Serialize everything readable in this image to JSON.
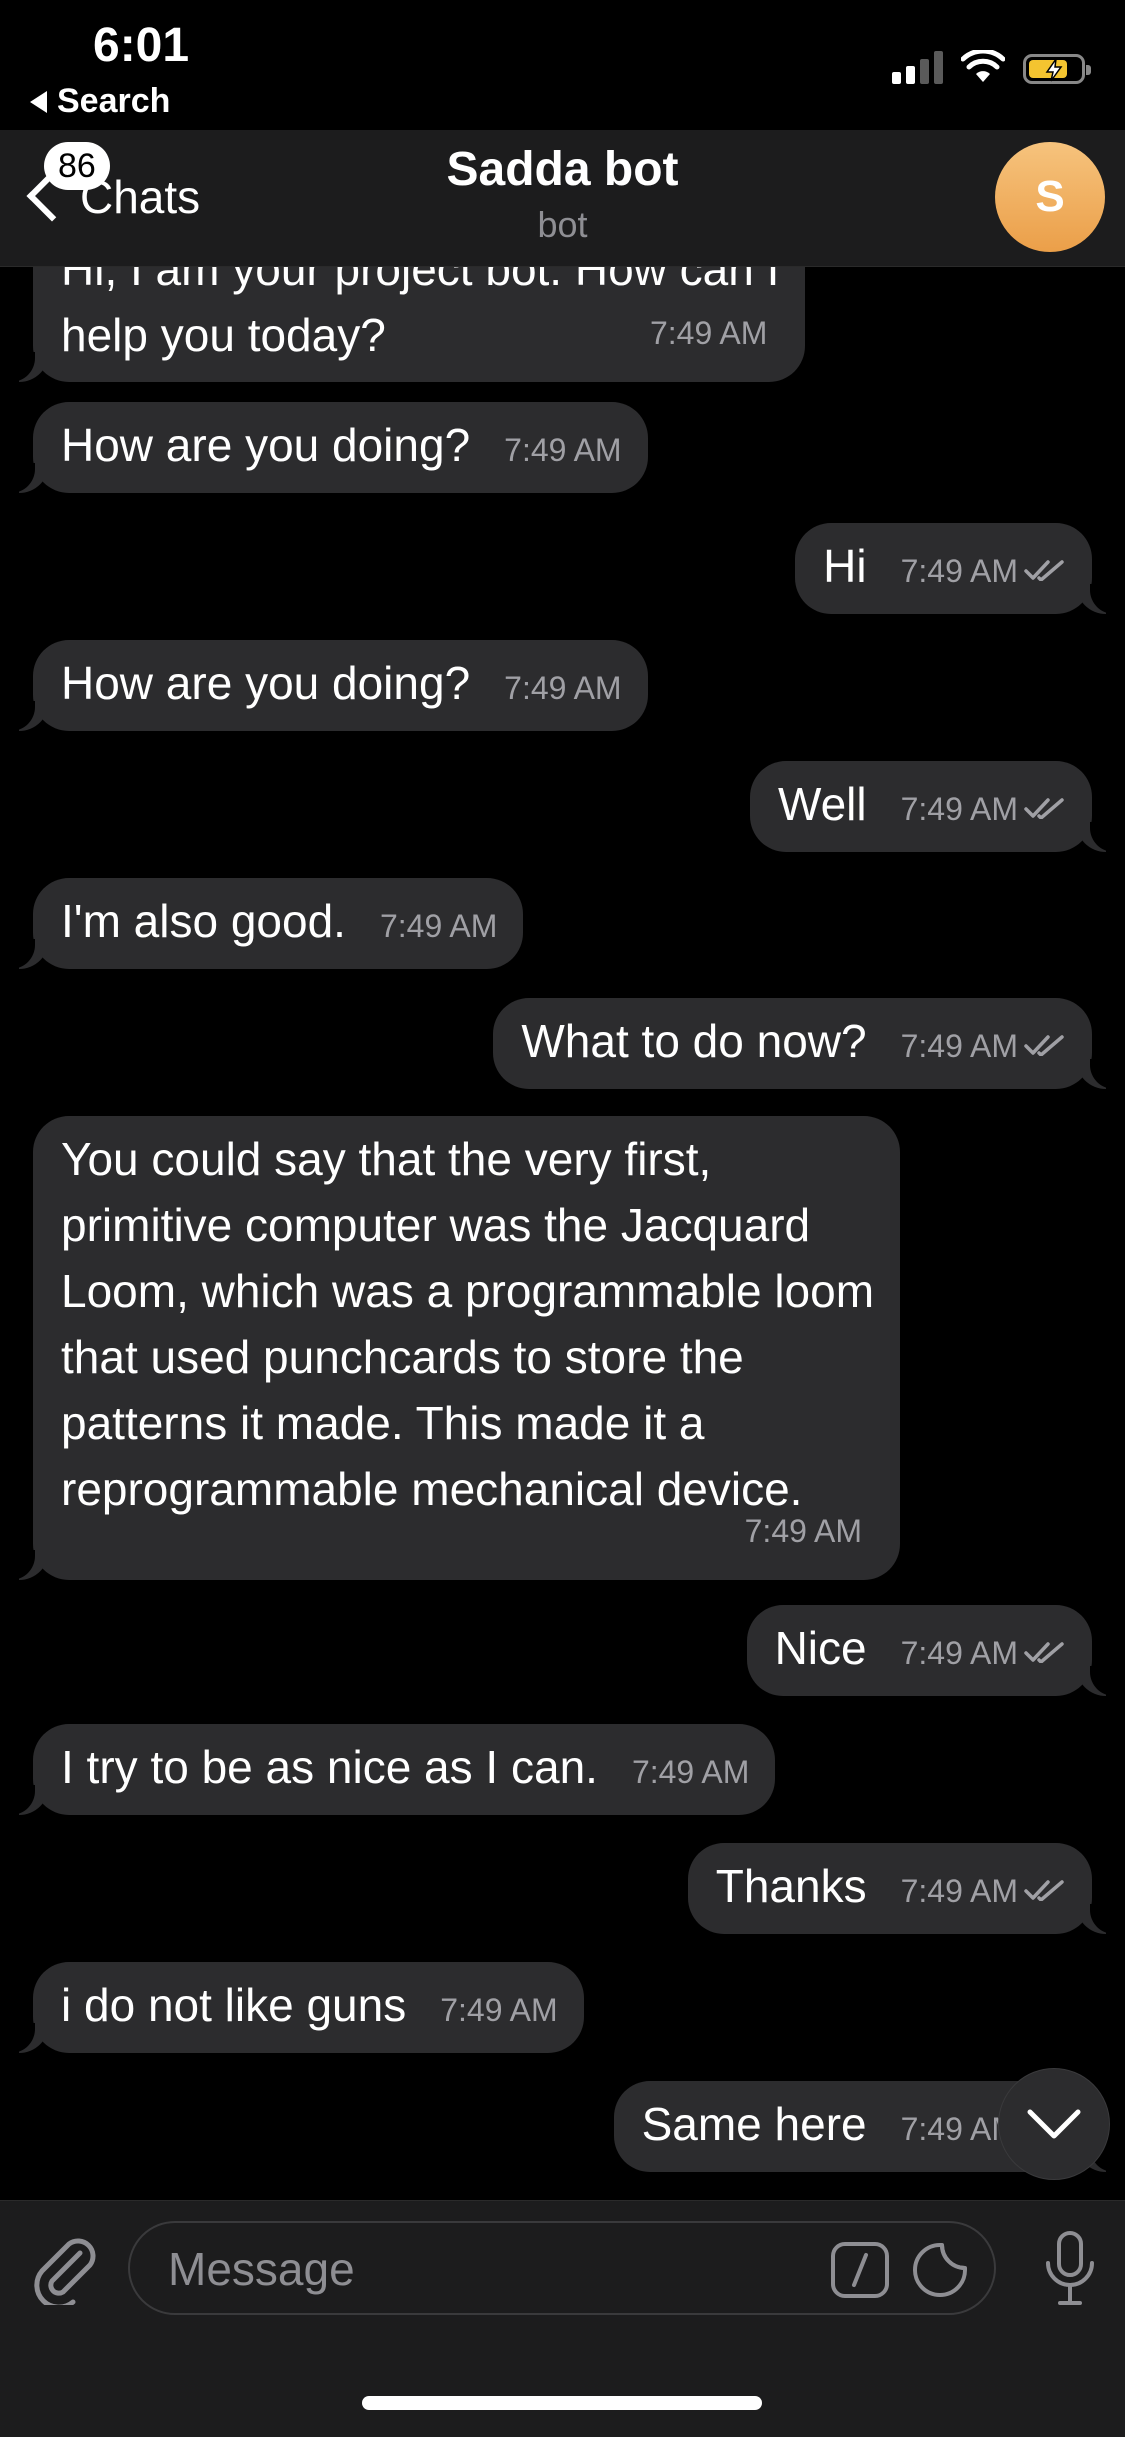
{
  "status_bar": {
    "time": "6:01",
    "back_app": "Search"
  },
  "header": {
    "back_label": "Chats",
    "unread_badge": "86",
    "title": "Sadda bot",
    "subtitle": "bot",
    "avatar_initial": "S"
  },
  "messages": [
    {
      "dir": "in",
      "text": "Hi, I am your project bot. How can I\nhelp you today?",
      "time": "7:49 AM"
    },
    {
      "dir": "in",
      "text": "How are you doing?",
      "time": "7:49 AM"
    },
    {
      "dir": "out",
      "text": "Hi",
      "time": "7:49 AM"
    },
    {
      "dir": "in",
      "text": "How are you doing?",
      "time": "7:49 AM"
    },
    {
      "dir": "out",
      "text": "Well",
      "time": "7:49 AM"
    },
    {
      "dir": "in",
      "text": "I'm also good.",
      "time": "7:49 AM"
    },
    {
      "dir": "out",
      "text": "What to do now?",
      "time": "7:49 AM"
    },
    {
      "dir": "in",
      "text": "You could say that the very first,\nprimitive computer was the Jacquard\nLoom, which was a programmable loom\nthat used punchcards to store the\npatterns it made. This made it a\nreprogrammable mechanical device.",
      "time": "7:49 AM"
    },
    {
      "dir": "out",
      "text": "Nice",
      "time": "7:49 AM"
    },
    {
      "dir": "in",
      "text": "I try to be as nice as I can.",
      "time": "7:49 AM"
    },
    {
      "dir": "out",
      "text": "Thanks",
      "time": "7:49 AM"
    },
    {
      "dir": "in",
      "text": "i do not like guns",
      "time": "7:49 AM"
    },
    {
      "dir": "out",
      "text": "Same here",
      "time": "7:49 AM"
    }
  ],
  "composer": {
    "placeholder": "Message"
  },
  "colors": {
    "bubble": "#2c2c2e",
    "background": "#000000",
    "avatar": "#f0a955",
    "battery": "#f4c430"
  }
}
